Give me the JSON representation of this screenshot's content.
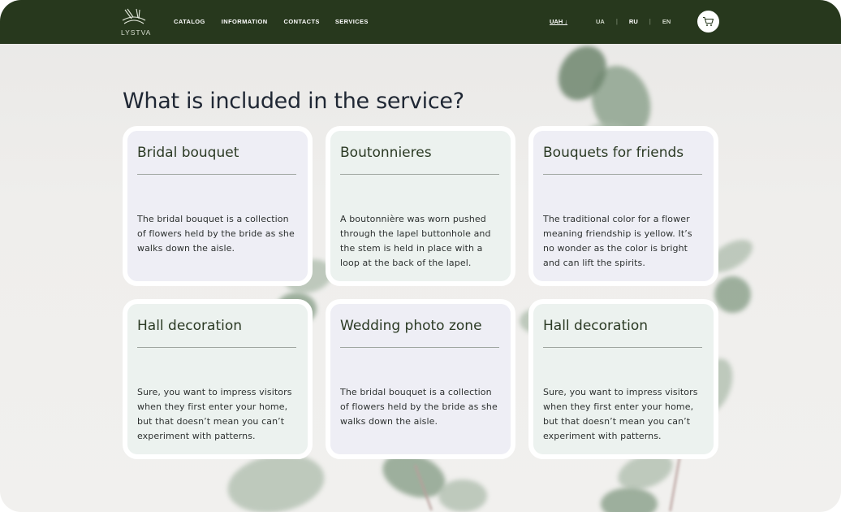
{
  "header": {
    "logo_text": "LYSTVA",
    "nav": [
      "CATALOG",
      "INFORMATION",
      "CONTACTS",
      "SERVICES"
    ],
    "currency": "UAH ↓",
    "languages": [
      "UA",
      "RU",
      "EN"
    ],
    "active_language": "RU",
    "cart_icon": "cart-icon"
  },
  "main": {
    "title": "What is included in the service?",
    "cards": [
      {
        "title": "Bridal bouquet",
        "text": "The bridal bouquet is a collection of flowers held by the bride as she walks down the aisle."
      },
      {
        "title": "Boutonnieres",
        "text": "A boutonnière was worn pushed through the lapel buttonhole and the stem is held in place with a loop at the back of the lapel."
      },
      {
        "title": "Bouquets for friends",
        "text": "The traditional color for a flower meaning friendship is yellow. It’s no wonder as the color is bright and can lift the spirits."
      },
      {
        "title": "Hall decoration",
        "text": "Sure, you want to impress visitors when they first enter your home, but that doesn’t mean you can’t experiment with patterns."
      },
      {
        "title": "Wedding photo zone",
        "text": "The bridal bouquet is a collection of flowers held by the bride as she walks down the aisle."
      },
      {
        "title": "Hall decoration",
        "text": "Sure, you want to impress visitors when they first enter your home, but that doesn’t mean you can’t experiment with patterns."
      }
    ]
  },
  "colors": {
    "header_bg": "#27381d",
    "card_lavender": "#eeeef5",
    "card_mint": "#ecf2ef",
    "title_color": "#1f2734"
  }
}
